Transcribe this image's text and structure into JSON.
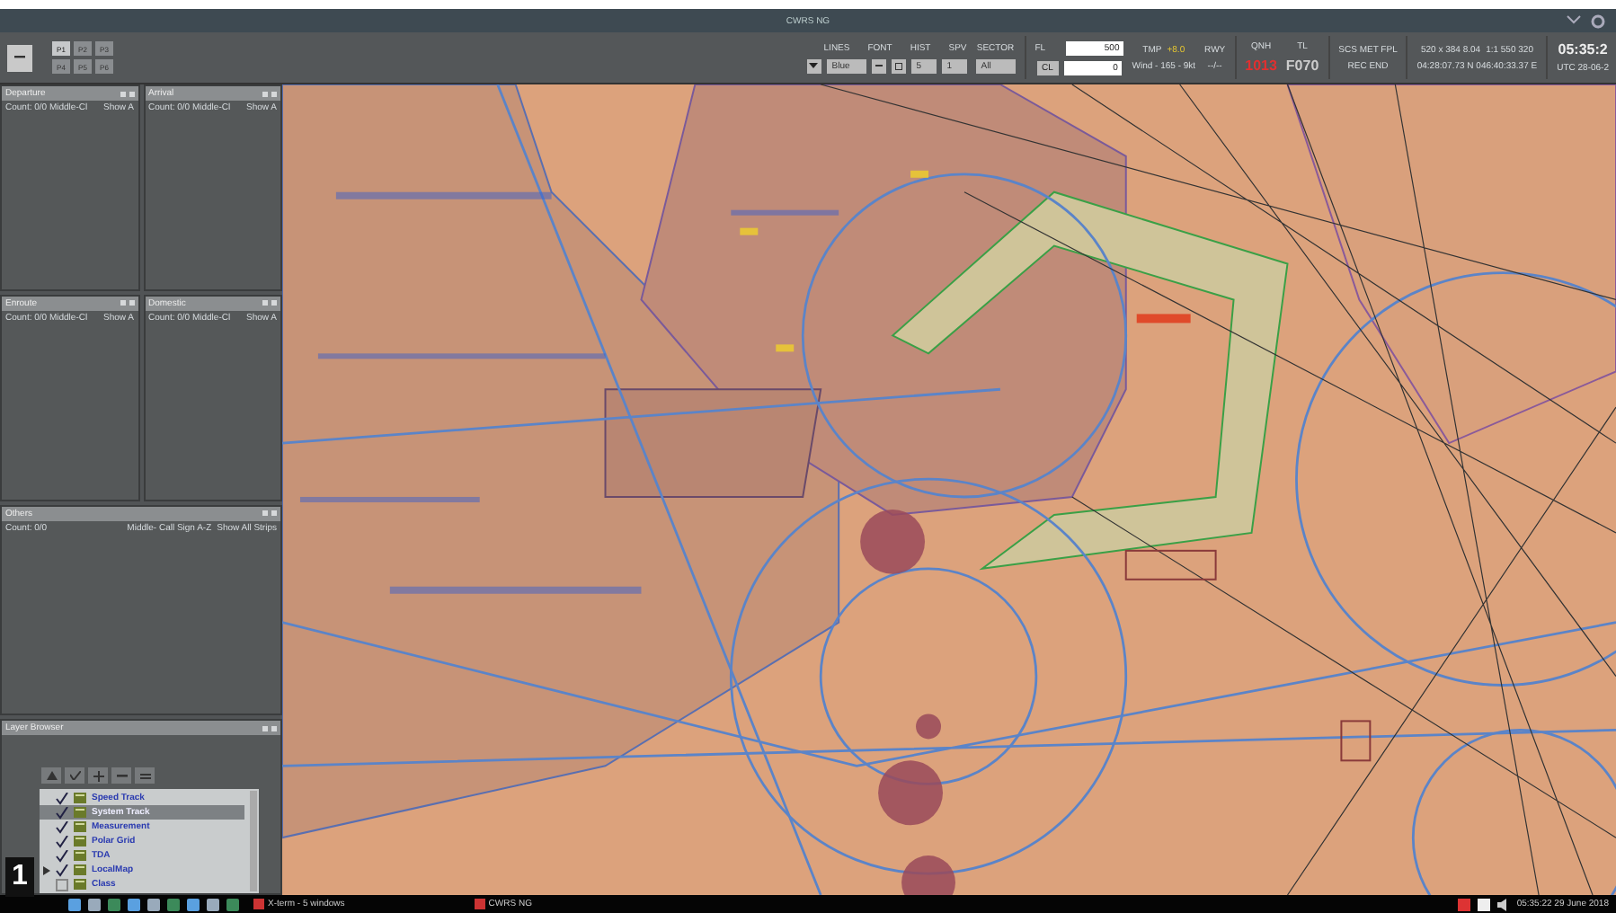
{
  "window": {
    "title": "CWRS NG"
  },
  "toolbar": {
    "preset_buttons": [
      {
        "label": "P1",
        "selected": true
      },
      {
        "label": "P2",
        "selected": false
      },
      {
        "label": "P3",
        "selected": false
      },
      {
        "label": "P4",
        "selected": false
      },
      {
        "label": "P5",
        "selected": false
      },
      {
        "label": "P6",
        "selected": false
      }
    ],
    "display_labels": [
      "LINES",
      "FONT",
      "HIST",
      "SPV"
    ],
    "color_value": "Blue",
    "hist_value": "5",
    "spv_value": "1",
    "sector": {
      "label": "SECTOR",
      "value": "All"
    },
    "fl": {
      "label": "FL",
      "value": "500"
    },
    "cl": {
      "label": "CL",
      "value": "0"
    },
    "tmp": {
      "label": "TMP",
      "value": "+8.0"
    },
    "wind": "Wind - 165 - 9kt",
    "rwy": {
      "label": "RWY",
      "value": "--/--"
    },
    "qnh": {
      "label": "QNH",
      "value": "1013"
    },
    "tl": {
      "label": "TL",
      "value": "F070"
    },
    "info_top": "SCS MET FPL",
    "info_bottom": "REC END",
    "range": "520 x 384 8.04",
    "scale": "1:1 550 320",
    "coords": "04:28:07.73 N 046:40:33.37 E",
    "clock": "05:35:2",
    "date": "UTC 28-06-2"
  },
  "panels": [
    {
      "title": "Departure",
      "count": "Count: 0/0 Middle-Cl",
      "show": "Show A"
    },
    {
      "title": "Arrival",
      "count": "Count: 0/0 Middle-Cl",
      "show": "Show A"
    },
    {
      "title": "Enroute",
      "count": "Count: 0/0 Middle-Cl",
      "show": "Show A"
    },
    {
      "title": "Domestic",
      "count": "Count: 0/0 Middle-Cl",
      "show": "Show A"
    }
  ],
  "others": {
    "title": "Others",
    "count": "Count: 0/0",
    "sort": "Middle- Call Sign A-Z",
    "show": "Show All Strips"
  },
  "layer_browser": {
    "title": "Layer Browser",
    "items": [
      {
        "label": "Speed Track",
        "checked": true,
        "selected": false,
        "expandable": false
      },
      {
        "label": "System Track",
        "checked": true,
        "selected": true,
        "expandable": false
      },
      {
        "label": "Measurement",
        "checked": true,
        "selected": false,
        "expandable": false
      },
      {
        "label": "Polar Grid",
        "checked": true,
        "selected": false,
        "expandable": false
      },
      {
        "label": "TDA",
        "checked": true,
        "selected": false,
        "expandable": false
      },
      {
        "label": "LocalMap",
        "checked": true,
        "selected": false,
        "expandable": true
      },
      {
        "label": "Class",
        "checked": false,
        "selected": false,
        "expandable": false
      }
    ]
  },
  "figure_label": "1",
  "taskbar": {
    "windows": [
      {
        "label": "X-term - 5 windows"
      },
      {
        "label": "CWRS NG"
      }
    ],
    "clock": "05:35:22 29 June 2018"
  }
}
